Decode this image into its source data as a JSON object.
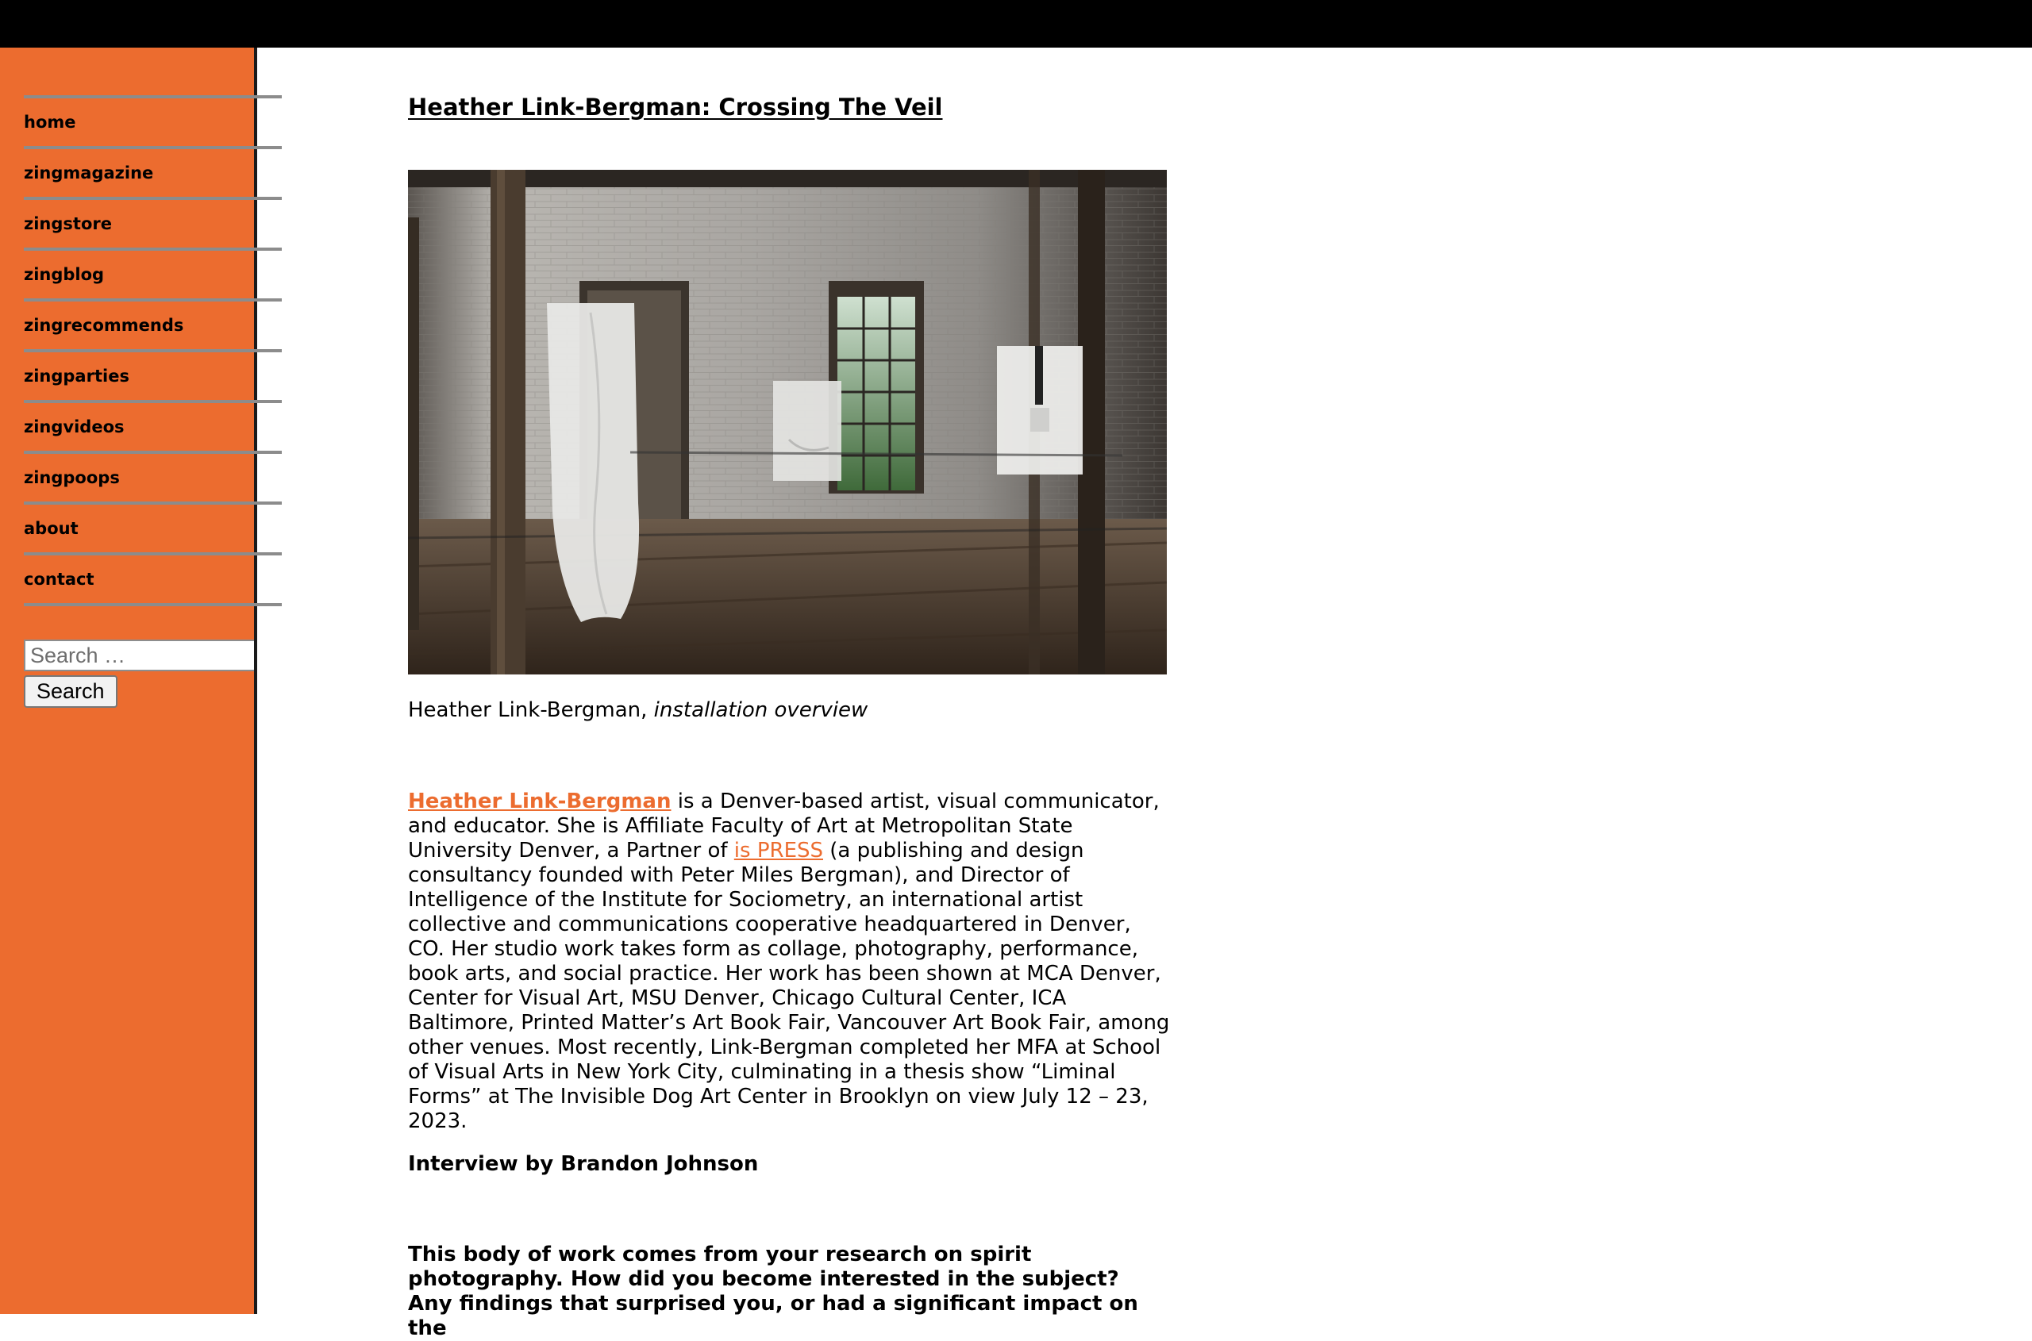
{
  "nav": {
    "items": [
      {
        "label": "home"
      },
      {
        "label": "zingmagazine"
      },
      {
        "label": "zingstore"
      },
      {
        "label": "zingblog"
      },
      {
        "label": "zingrecommends"
      },
      {
        "label": "zingparties"
      },
      {
        "label": "zingvideos"
      },
      {
        "label": "zingpoops"
      },
      {
        "label": "about"
      },
      {
        "label": "contact"
      }
    ]
  },
  "search": {
    "placeholder": "Search …",
    "button_label": "Search"
  },
  "post": {
    "title": "Heather Link-Bergman: Crossing The Veil",
    "caption_name": "Heather Link-Bergman, ",
    "caption_italic": "installation overview",
    "intro": {
      "artist_link": "Heather Link-Bergman",
      "text_1": " is a Denver-based artist, visual communicator, and educator. She is Affiliate Faculty of Art at Metropolitan State University Denver, a Partner of ",
      "press_link": "is PRESS",
      "text_2": " (a publishing and design consultancy founded with Peter Miles Bergman), and Director of Intelligence of the Institute for Sociometry, an international artist collective and communications cooperative headquartered in Denver, CO. Her studio work takes form as collage, photography, performance, book arts, and social practice. Her work has been shown at MCA Denver, Center for Visual Art, MSU Denver, Chicago Cultural Center, ICA Baltimore, Printed Matter’s Art Book Fair, Vancouver Art Book Fair, among other venues. Most recently, Link-Bergman completed her MFA at School of Visual Arts in New York City, culminating in a thesis show “Liminal Forms” at The Invisible Dog Art Center in Brooklyn on view July 12 – 23, 2023."
    },
    "byline": "Interview by Brandon Johnson",
    "question": "This body of work comes from your research on spirit photography. How did you become interested in the subject? Any findings that surprised you, or had a significant impact on the"
  },
  "colors": {
    "sidebar_bg": "#ec6c2f",
    "topbar_bg": "#000000",
    "link": "#ec6c2f"
  }
}
